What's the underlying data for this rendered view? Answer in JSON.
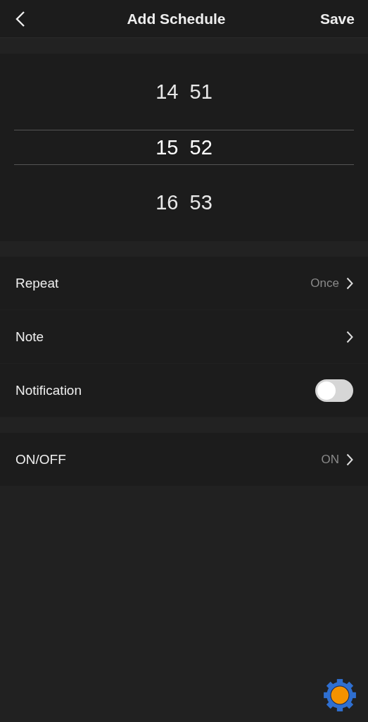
{
  "header": {
    "title": "Add Schedule",
    "action": "Save"
  },
  "time_picker": {
    "rows": [
      {
        "hour": "14",
        "minute": "51",
        "selected": false
      },
      {
        "hour": "15",
        "minute": "52",
        "selected": true
      },
      {
        "hour": "16",
        "minute": "53",
        "selected": false
      }
    ]
  },
  "settings": [
    {
      "kind": "link",
      "label": "Repeat",
      "value": "Once"
    },
    {
      "kind": "link",
      "label": "Note"
    },
    {
      "kind": "toggle",
      "label": "Notification",
      "on": false
    }
  ],
  "settings_2": [
    {
      "kind": "link",
      "label": "ON/OFF",
      "value": "ON"
    }
  ]
}
